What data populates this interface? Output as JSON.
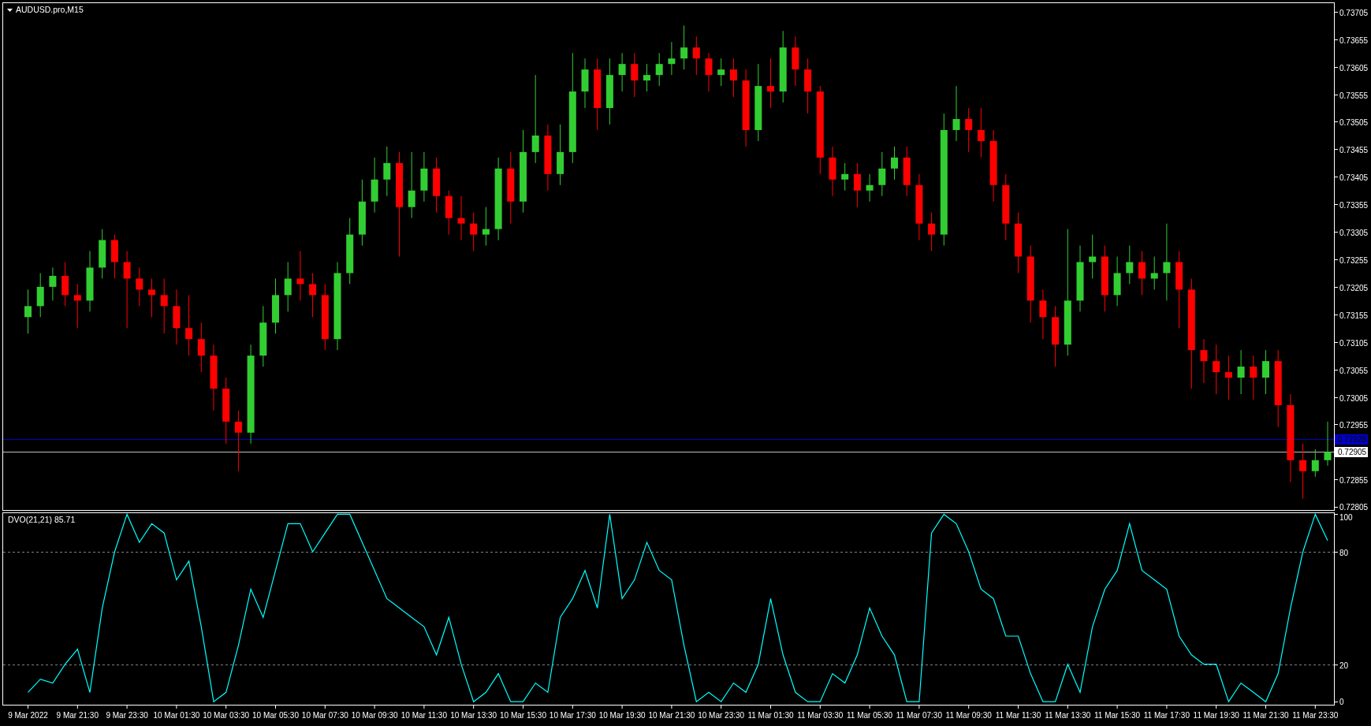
{
  "chart": {
    "title": "AUDUSD.pro,M15",
    "chart_data": {
      "type": "candlestick",
      "ylim": [
        0.72798,
        0.73722
      ],
      "categories": [
        null,
        null,
        null,
        null,
        null,
        null,
        null,
        null,
        null,
        null,
        null,
        null,
        null,
        null,
        null,
        null,
        null,
        null,
        null,
        null,
        null,
        null,
        null,
        null,
        null,
        null,
        null,
        null,
        null,
        null,
        null,
        null,
        null,
        null,
        null,
        null,
        null,
        null,
        null,
        null,
        null,
        null,
        null,
        null,
        null,
        null,
        null,
        null,
        null,
        null,
        null,
        null,
        null,
        null,
        null,
        null,
        null,
        null,
        null,
        null,
        null,
        null,
        null,
        null,
        null,
        null,
        null,
        null,
        null,
        null,
        null,
        null,
        null,
        null,
        null,
        null,
        null,
        null,
        null,
        null,
        null,
        null,
        null,
        null,
        null,
        null,
        null,
        null,
        null,
        null,
        null,
        null,
        null,
        null,
        null,
        null,
        null,
        null,
        null,
        null,
        null,
        null,
        null,
        null,
        null,
        null
      ],
      "ohlc": [
        [
          0.7315,
          0.732,
          0.7312,
          0.7317
        ],
        [
          0.7317,
          0.7323,
          0.7315,
          0.73205
        ],
        [
          0.73205,
          0.7324,
          0.7318,
          0.73225
        ],
        [
          0.73225,
          0.7325,
          0.7317,
          0.7319
        ],
        [
          0.7319,
          0.7321,
          0.7313,
          0.7318
        ],
        [
          0.7318,
          0.7327,
          0.7316,
          0.7324
        ],
        [
          0.7324,
          0.7331,
          0.7322,
          0.7329
        ],
        [
          0.7329,
          0.733,
          0.7322,
          0.7325
        ],
        [
          0.7325,
          0.7327,
          0.7313,
          0.7322
        ],
        [
          0.7322,
          0.7324,
          0.7317,
          0.732
        ],
        [
          0.732,
          0.7322,
          0.7315,
          0.7319
        ],
        [
          0.7319,
          0.7322,
          0.7312,
          0.7317
        ],
        [
          0.7317,
          0.732,
          0.731,
          0.7313
        ],
        [
          0.7313,
          0.7319,
          0.7308,
          0.7311
        ],
        [
          0.7311,
          0.7314,
          0.7305,
          0.7308
        ],
        [
          0.7308,
          0.731,
          0.7298,
          0.7302
        ],
        [
          0.7302,
          0.7304,
          0.7292,
          0.7296
        ],
        [
          0.7296,
          0.7298,
          0.7287,
          0.7294
        ],
        [
          0.7294,
          0.731,
          0.7292,
          0.7308
        ],
        [
          0.7308,
          0.7317,
          0.7306,
          0.7314
        ],
        [
          0.7314,
          0.7322,
          0.7312,
          0.7319
        ],
        [
          0.7319,
          0.7325,
          0.7316,
          0.7322
        ],
        [
          0.7322,
          0.7327,
          0.7318,
          0.7321
        ],
        [
          0.7321,
          0.7323,
          0.7315,
          0.7319
        ],
        [
          0.7319,
          0.7321,
          0.7309,
          0.7311
        ],
        [
          0.7311,
          0.7325,
          0.7309,
          0.7323
        ],
        [
          0.7323,
          0.7333,
          0.7321,
          0.733
        ],
        [
          0.733,
          0.734,
          0.7328,
          0.7336
        ],
        [
          0.7336,
          0.7344,
          0.7334,
          0.734
        ],
        [
          0.734,
          0.7346,
          0.7337,
          0.7343
        ],
        [
          0.7343,
          0.7345,
          0.7326,
          0.7335
        ],
        [
          0.7335,
          0.7345,
          0.7333,
          0.7338
        ],
        [
          0.7338,
          0.7345,
          0.7336,
          0.7342
        ],
        [
          0.7342,
          0.7344,
          0.7334,
          0.7337
        ],
        [
          0.7337,
          0.7338,
          0.733,
          0.7333
        ],
        [
          0.7333,
          0.7337,
          0.7329,
          0.7332
        ],
        [
          0.7332,
          0.7334,
          0.7327,
          0.733
        ],
        [
          0.733,
          0.7335,
          0.7328,
          0.7331
        ],
        [
          0.7331,
          0.7344,
          0.7329,
          0.7342
        ],
        [
          0.7342,
          0.7345,
          0.7332,
          0.7336
        ],
        [
          0.7336,
          0.7349,
          0.7334,
          0.7345
        ],
        [
          0.7345,
          0.7359,
          0.7343,
          0.7348
        ],
        [
          0.7348,
          0.735,
          0.7338,
          0.7341
        ],
        [
          0.7341,
          0.735,
          0.7339,
          0.7345
        ],
        [
          0.7345,
          0.7363,
          0.7343,
          0.7356
        ],
        [
          0.7356,
          0.7362,
          0.7353,
          0.736
        ],
        [
          0.736,
          0.7362,
          0.7349,
          0.7353
        ],
        [
          0.7353,
          0.7362,
          0.735,
          0.7359
        ],
        [
          0.7359,
          0.7363,
          0.7356,
          0.7361
        ],
        [
          0.7361,
          0.7363,
          0.7355,
          0.7358
        ],
        [
          0.7358,
          0.7361,
          0.7356,
          0.7359
        ],
        [
          0.7359,
          0.7363,
          0.7357,
          0.7361
        ],
        [
          0.7361,
          0.7365,
          0.7359,
          0.7362
        ],
        [
          0.7362,
          0.7368,
          0.736,
          0.7364
        ],
        [
          0.7364,
          0.7366,
          0.7359,
          0.7362
        ],
        [
          0.7362,
          0.7363,
          0.7356,
          0.7359
        ],
        [
          0.7359,
          0.7362,
          0.7357,
          0.736
        ],
        [
          0.736,
          0.7362,
          0.7355,
          0.7358
        ],
        [
          0.7358,
          0.736,
          0.7346,
          0.7349
        ],
        [
          0.7349,
          0.7361,
          0.7347,
          0.7357
        ],
        [
          0.7357,
          0.7362,
          0.7353,
          0.7356
        ],
        [
          0.7356,
          0.7367,
          0.7354,
          0.7364
        ],
        [
          0.7364,
          0.7366,
          0.7357,
          0.736
        ],
        [
          0.736,
          0.7362,
          0.7352,
          0.7356
        ],
        [
          0.7356,
          0.7357,
          0.7341,
          0.7344
        ],
        [
          0.7344,
          0.7346,
          0.7337,
          0.734
        ],
        [
          0.734,
          0.7343,
          0.7338,
          0.7341
        ],
        [
          0.7341,
          0.7343,
          0.7335,
          0.7338
        ],
        [
          0.7338,
          0.7341,
          0.7336,
          0.7339
        ],
        [
          0.7339,
          0.7345,
          0.7337,
          0.7342
        ],
        [
          0.7342,
          0.7346,
          0.734,
          0.7344
        ],
        [
          0.7344,
          0.7346,
          0.7337,
          0.7339
        ],
        [
          0.7339,
          0.7341,
          0.7329,
          0.7332
        ],
        [
          0.7332,
          0.7334,
          0.7327,
          0.733
        ],
        [
          0.733,
          0.7352,
          0.7328,
          0.7349
        ],
        [
          0.7349,
          0.7357,
          0.7347,
          0.7351
        ],
        [
          0.7351,
          0.7353,
          0.7345,
          0.7349
        ],
        [
          0.7349,
          0.7353,
          0.7344,
          0.7347
        ],
        [
          0.7347,
          0.7349,
          0.7336,
          0.7339
        ],
        [
          0.7339,
          0.7341,
          0.7329,
          0.7332
        ],
        [
          0.7332,
          0.7334,
          0.7323,
          0.7326
        ],
        [
          0.7326,
          0.7328,
          0.7314,
          0.7318
        ],
        [
          0.7318,
          0.732,
          0.7311,
          0.7315
        ],
        [
          0.7315,
          0.7317,
          0.7306,
          0.731
        ],
        [
          0.731,
          0.7331,
          0.7308,
          0.7318
        ],
        [
          0.7318,
          0.7328,
          0.7316,
          0.7325
        ],
        [
          0.7325,
          0.733,
          0.7322,
          0.7326
        ],
        [
          0.7326,
          0.7328,
          0.7316,
          0.7319
        ],
        [
          0.7319,
          0.7326,
          0.7317,
          0.7323
        ],
        [
          0.7323,
          0.7328,
          0.7321,
          0.7325
        ],
        [
          0.7325,
          0.7327,
          0.7319,
          0.7322
        ],
        [
          0.7322,
          0.7326,
          0.732,
          0.7323
        ],
        [
          0.7323,
          0.7332,
          0.7318,
          0.7325
        ],
        [
          0.7325,
          0.7327,
          0.7313,
          0.732
        ],
        [
          0.732,
          0.7322,
          0.7302,
          0.7309
        ],
        [
          0.7309,
          0.7311,
          0.7303,
          0.7307
        ],
        [
          0.7307,
          0.731,
          0.7301,
          0.7305
        ],
        [
          0.7305,
          0.7308,
          0.73,
          0.7304
        ],
        [
          0.7304,
          0.7309,
          0.7301,
          0.7306
        ],
        [
          0.7306,
          0.7308,
          0.73,
          0.7304
        ],
        [
          0.7304,
          0.7309,
          0.7301,
          0.7307
        ],
        [
          0.7307,
          0.7309,
          0.7295,
          0.7299
        ],
        [
          0.7299,
          0.7301,
          0.7285,
          0.7289
        ],
        [
          0.7289,
          0.7292,
          0.7282,
          0.7287
        ],
        [
          0.7287,
          0.7291,
          0.7286,
          0.7289
        ],
        [
          0.7289,
          0.7296,
          0.7288,
          0.72905
        ]
      ],
      "yticks": [
        {
          "value": 0.73705,
          "label": "0.73705"
        },
        {
          "value": 0.73655,
          "label": "0.73655"
        },
        {
          "value": 0.73605,
          "label": "0.73605"
        },
        {
          "value": 0.73555,
          "label": "0.73555"
        },
        {
          "value": 0.73505,
          "label": "0.73505"
        },
        {
          "value": 0.73455,
          "label": "0.73455"
        },
        {
          "value": 0.73405,
          "label": "0.73405"
        },
        {
          "value": 0.73355,
          "label": "0.73355"
        },
        {
          "value": 0.73305,
          "label": "0.73305"
        },
        {
          "value": 0.73255,
          "label": "0.73255"
        },
        {
          "value": 0.73205,
          "label": "0.73205"
        },
        {
          "value": 0.73155,
          "label": "0.73155"
        },
        {
          "value": 0.73105,
          "label": "0.73105"
        },
        {
          "value": 0.73055,
          "label": "0.73055"
        },
        {
          "value": 0.73005,
          "label": "0.73005"
        },
        {
          "value": 0.72955,
          "label": "0.72955"
        },
        {
          "value": 0.72855,
          "label": "0.72855"
        },
        {
          "value": 0.72805,
          "label": "0.72805"
        }
      ],
      "ref_lines": [
        {
          "axis": "y",
          "value": 0.72928,
          "label": "0.72928",
          "color": "#0000c8"
        },
        {
          "axis": "y",
          "value": 0.72905,
          "label": "0.72905",
          "color": "#c0c0c0"
        }
      ]
    }
  },
  "indicator": {
    "title": "DVO(21,21) 85.71",
    "chart_data": {
      "type": "line",
      "ylim": [
        -2,
        101
      ],
      "yticks": [
        0,
        20,
        80,
        100
      ],
      "categories": [
        "9 Mar 2022",
        null,
        null,
        null,
        "9 Mar 21:30",
        null,
        null,
        null,
        "9 Mar 23:30",
        null,
        null,
        null,
        "10 Mar 01:30",
        null,
        null,
        null,
        "10 Mar 03:30",
        null,
        null,
        null,
        "10 Mar 05:30",
        null,
        null,
        null,
        "10 Mar 07:30",
        null,
        null,
        null,
        "10 Mar 09:30",
        null,
        null,
        null,
        "10 Mar 11:30",
        null,
        null,
        null,
        "10 Mar 13:30",
        null,
        null,
        null,
        "10 Mar 15:30",
        null,
        null,
        null,
        "10 Mar 17:30",
        null,
        null,
        null,
        "10 Mar 19:30",
        null,
        null,
        null,
        "10 Mar 21:30",
        null,
        null,
        null,
        "10 Mar 23:30",
        null,
        null,
        null,
        "11 Mar 01:30",
        null,
        null,
        null,
        "11 Mar 03:30",
        null,
        null,
        null,
        "11 Mar 05:30",
        null,
        null,
        null,
        "11 Mar 07:30",
        null,
        null,
        null,
        "11 Mar 09:30",
        null,
        null,
        null,
        "11 Mar 11:30",
        null,
        null,
        null,
        "11 Mar 13:30",
        null,
        null,
        null,
        "11 Mar 15:30",
        null,
        null,
        null,
        "11 Mar 17:30",
        null,
        null,
        null,
        "11 Mar 19:30",
        null,
        null,
        null,
        "11 Mar 21:30",
        null,
        null,
        null,
        "11 Mar 23:30",
        null
      ],
      "series": [
        {
          "color": "#00ffff",
          "values": [
            5,
            12,
            10,
            20,
            28,
            5,
            50,
            80,
            100,
            85,
            95,
            90,
            65,
            75,
            40,
            0,
            5,
            30,
            60,
            45,
            70,
            95,
            95,
            80,
            90,
            100,
            100,
            85,
            70,
            55,
            50,
            45,
            40,
            25,
            45,
            20,
            0,
            5,
            15,
            0,
            0,
            10,
            5,
            45,
            55,
            70,
            50,
            100,
            55,
            65,
            85,
            70,
            65,
            30,
            0,
            5,
            0,
            10,
            5,
            20,
            55,
            25,
            5,
            0,
            0,
            15,
            10,
            25,
            50,
            35,
            25,
            0,
            0,
            90,
            100,
            95,
            80,
            60,
            55,
            35,
            35,
            15,
            0,
            0,
            20,
            5,
            40,
            60,
            70,
            95,
            70,
            65,
            60,
            35,
            25,
            20,
            20,
            0,
            10,
            5,
            0,
            15,
            50,
            80,
            100,
            86
          ]
        }
      ],
      "ref_lines": [
        {
          "axis": "y",
          "value": 20
        },
        {
          "axis": "y",
          "value": 80
        }
      ]
    }
  }
}
